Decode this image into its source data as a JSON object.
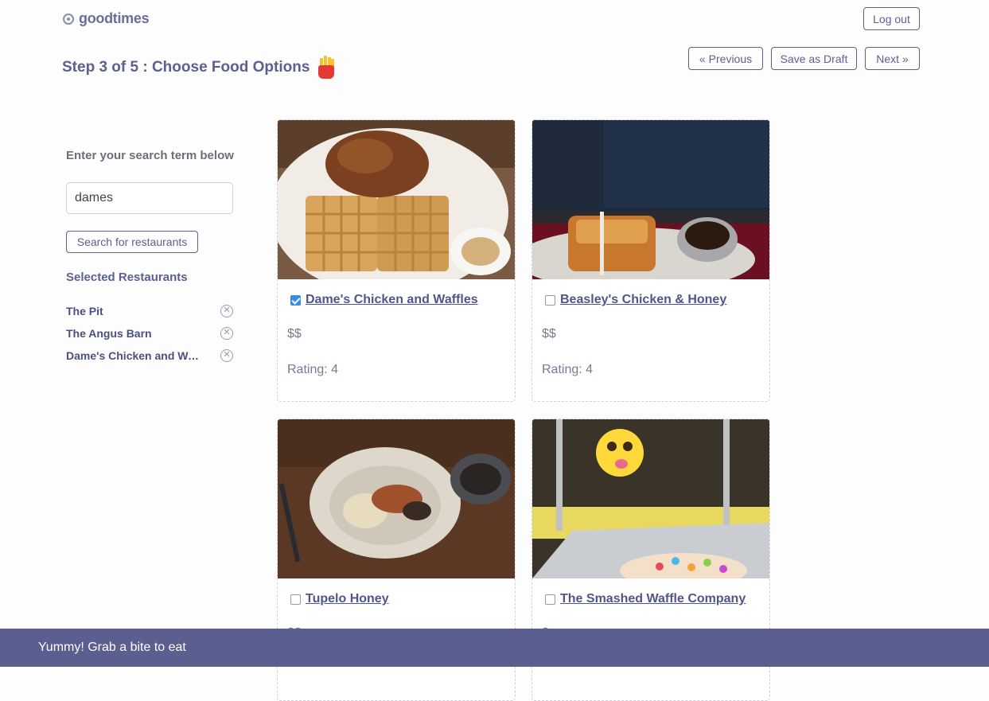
{
  "brand": {
    "name": "goodtimes"
  },
  "header": {
    "logout_label": "Log out"
  },
  "wizard": {
    "title": "Step 3 of 5 : Choose Food Options",
    "previous_label": "Previous",
    "save_draft_label": "Save as Draft",
    "next_label": "Next"
  },
  "sidebar": {
    "search_label": "Enter your search term below",
    "search_value": "dames",
    "search_button_label": "Search for restaurants",
    "selected_heading": "Selected Restaurants",
    "selected": [
      {
        "label": "The Pit"
      },
      {
        "label": "The Angus Barn"
      },
      {
        "label": "Dame's Chicken and Waffles"
      }
    ]
  },
  "results": [
    {
      "name": "Dame's Chicken and Waffles",
      "checked": true,
      "price": "$$",
      "rating": "Rating: 4",
      "photo": "chicken-and-waffles-photo"
    },
    {
      "name": "Beasley's Chicken & Honey",
      "checked": false,
      "price": "$$",
      "rating": "Rating: 4",
      "photo": "chicken-biscuit-photo"
    },
    {
      "name": "Tupelo Honey",
      "checked": false,
      "price": "$$",
      "rating": "",
      "photo": "plated-dish-photo"
    },
    {
      "name": "The Smashed Waffle Company",
      "checked": false,
      "price": "$",
      "rating": "",
      "photo": "cereal-waffle-photo"
    }
  ],
  "footer": {
    "text": "Yummy! Grab a bite to eat"
  },
  "colors": {
    "accent": "#5a5f8f",
    "checkbox_checked": "#3b8beb"
  }
}
